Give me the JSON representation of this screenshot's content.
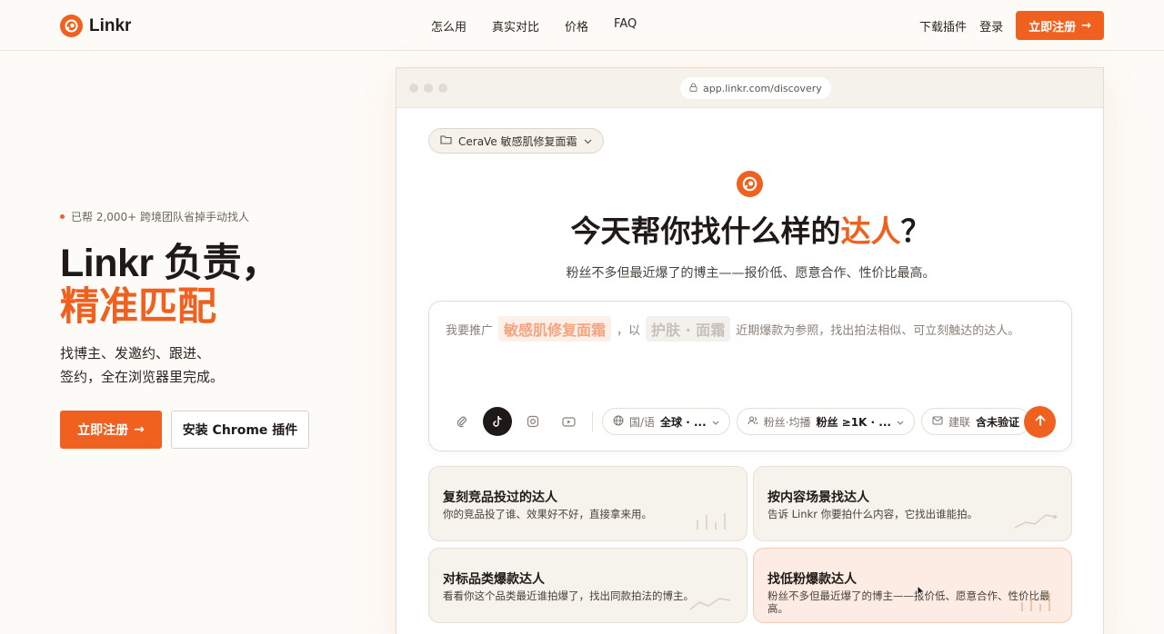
{
  "nav": {
    "brand": "Linkr",
    "links": [
      "怎么用",
      "真实对比",
      "价格",
      "FAQ"
    ],
    "download": "下载插件",
    "login": "登录",
    "signup": "立即注册",
    "signup_arrow": "→"
  },
  "hero": {
    "eyebrow": "已帮 2,000+ 跨境团队省掉手动找人",
    "headline_1": "Linkr 负责，",
    "headline_2": "精准匹配",
    "sub_1": "找博主、发邀约、跟进、",
    "sub_2": "签约，全在浏览器里完成。",
    "cta_primary": "立即注册",
    "cta_arrow": "→",
    "cta_secondary": "安装 Chrome 插件"
  },
  "browser": {
    "url": "app.linkr.com/discovery",
    "project": "CeraVe 敏感肌修复面霜",
    "title_pre": "今天帮你找什么样的",
    "title_accent": "达人",
    "title_post": "？",
    "subtitle": "粉丝不多但最近爆了的博主——报价低、愿意合作、性价比最高。",
    "prompt": {
      "p1": "我要推广",
      "tag1": "敏感肌修复面霜",
      "p2": "，以",
      "tag2": "护肤 · 面霜",
      "p3": "近期爆款为参照，找出拍法相似、可立刻触达的达人。"
    },
    "filters": [
      {
        "label": "国/语",
        "value": "全球 · ..."
      },
      {
        "label": "粉丝·均播",
        "value": "粉丝 ≥1K · ..."
      },
      {
        "label": "建联",
        "value": "含未验证"
      }
    ],
    "cards": [
      {
        "title": "复刻竞品投过的达人",
        "desc": "你的竞品投了谁、效果好不好，直接拿来用。"
      },
      {
        "title": "按内容场景找达人",
        "desc": "告诉 Linkr 你要拍什么内容，它找出谁能拍。"
      },
      {
        "title": "对标品类爆款达人",
        "desc": "看看你这个品类最近谁拍爆了，找出同款拍法的博主。"
      },
      {
        "title": "找低粉爆款达人",
        "desc": "粉丝不多但最近爆了的博主——报价低、愿意合作、性价比最高。"
      }
    ]
  },
  "colors": {
    "accent": "#f0601f",
    "bg": "#fdfbf7"
  }
}
